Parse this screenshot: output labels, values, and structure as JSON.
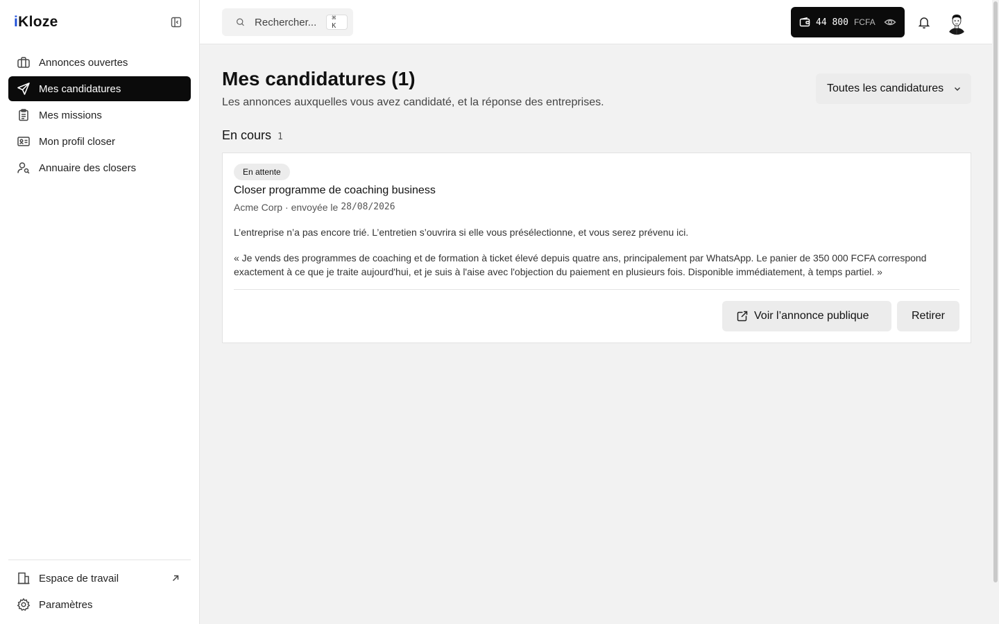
{
  "brand": {
    "logo_prefix": "i",
    "logo_rest": "Kloze"
  },
  "sidebar": {
    "items": [
      {
        "label": "Annonces ouvertes",
        "icon": "briefcase-icon",
        "active": false
      },
      {
        "label": "Mes candidatures",
        "icon": "send-icon",
        "active": true
      },
      {
        "label": "Mes missions",
        "icon": "clipboard-icon",
        "active": false
      },
      {
        "label": "Mon profil closer",
        "icon": "id-card-icon",
        "active": false
      },
      {
        "label": "Annuaire des closers",
        "icon": "user-search-icon",
        "active": false
      }
    ],
    "bottom_items": [
      {
        "label": "Espace de travail",
        "icon": "building-icon",
        "external_icon": "arrow-up-right-icon"
      },
      {
        "label": "Paramètres",
        "icon": "gear-icon"
      }
    ]
  },
  "topbar": {
    "search": {
      "placeholder": "Rechercher...",
      "shortcut": "⌘ K"
    },
    "wallet": {
      "amount": "44 800",
      "currency": "FCFA"
    }
  },
  "page": {
    "title": "Mes candidatures (1)",
    "subtitle": "Les annonces auxquelles vous avez candidaté, et la réponse des entreprises.",
    "filter": {
      "selected": "Toutes les candidatures"
    }
  },
  "section": {
    "title": "En cours",
    "count": "1"
  },
  "application": {
    "status_badge": "En attente",
    "title": "Closer programme de coaching business",
    "company": "Acme Corp",
    "sent_prefix": "· envoyée le",
    "sent_date": "28/08/2026",
    "status_text": "L’entreprise n’a pas encore trié. L’entretien s’ouvrira si elle vous présélectionne, et vous serez prévenu ici.",
    "quote": "« Je vends des programmes de coaching et de formation à ticket élevé depuis quatre ans, principalement par WhatsApp. Le panier de 350 000 FCFA correspond exactement à ce que je traite aujourd'hui, et je suis à l'aise avec l'objection du paiement en plusieurs fois. Disponible immédiatement, à temps partiel. »",
    "view_button": "Voir l’annonce publique",
    "withdraw_button": "Retirer"
  }
}
